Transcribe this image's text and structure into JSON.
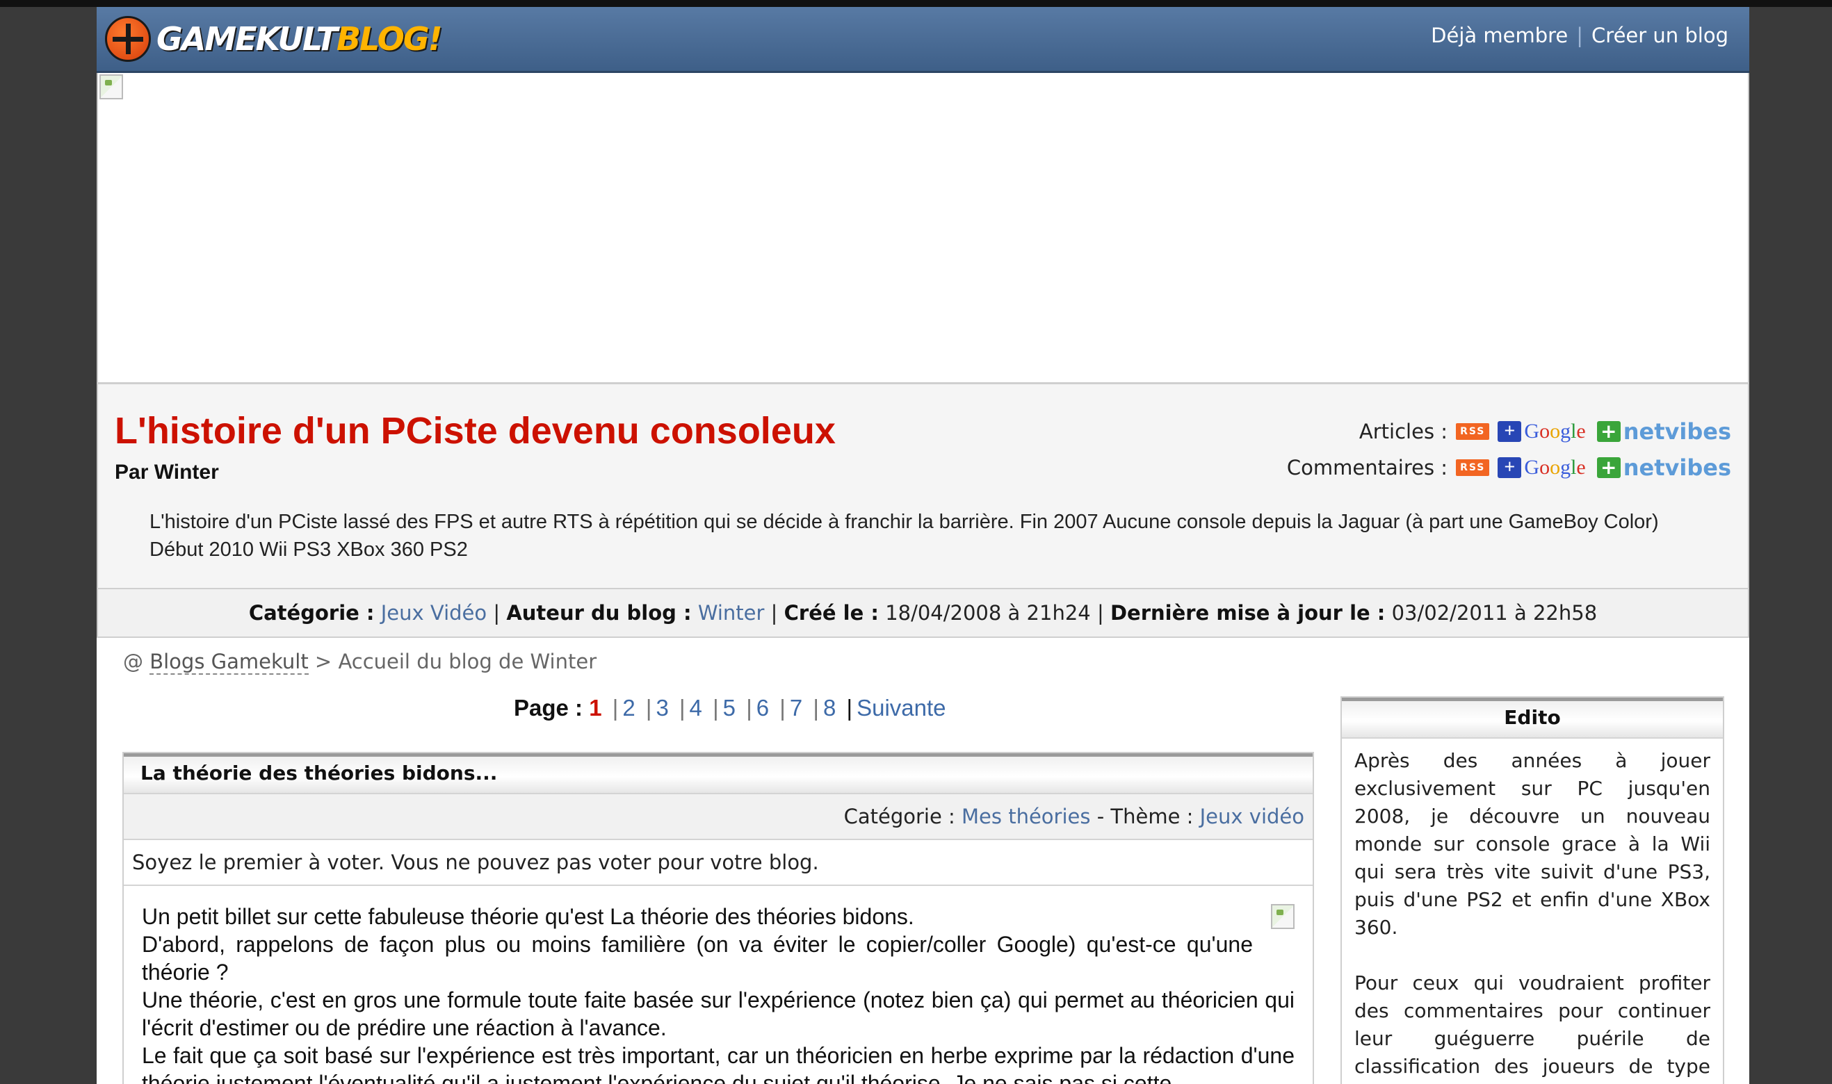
{
  "header": {
    "logo_main": "GAMEKULT",
    "logo_blog": "BLOG!",
    "link_member": "Déjà membre",
    "link_separator": "|",
    "link_create": "Créer un blog"
  },
  "blog": {
    "title": "L'histoire d'un PCiste devenu consoleux",
    "author": "Par Winter",
    "description": "L'histoire d'un PCiste lassé des FPS et autre RTS à répétition qui se décide à franchir la barrière. Fin 2007 Aucune console depuis la Jaguar (à part une GameBoy Color) Début 2010 Wii PS3 XBox 360 PS2"
  },
  "feeds": {
    "articles_label": "Articles :",
    "comments_label": "Commentaires :",
    "rss": "RSS",
    "google": [
      "G",
      "o",
      "o",
      "g",
      "l",
      "e"
    ],
    "netvibes": "netvibes"
  },
  "meta": {
    "category_label": "Catégorie :",
    "category_value": "Jeux Vidéo",
    "author_label": "Auteur du blog :",
    "author_value": "Winter",
    "created_label": "Créé le :",
    "created_value": "18/04/2008 à 21h24",
    "updated_label": "Dernière mise à jour le :",
    "updated_value": "03/02/2011 à 22h58",
    "separator": "|"
  },
  "breadcrumb": {
    "prefix": "@",
    "home": "Blogs Gamekult",
    "current": "> Accueil du blog de Winter"
  },
  "pagination": {
    "label": "Page :",
    "current": "1",
    "pages": [
      "2",
      "3",
      "4",
      "5",
      "6",
      "7",
      "8"
    ],
    "next": "Suivante"
  },
  "article": {
    "title": "La théorie des théories bidons...",
    "category_label": "Catégorie :",
    "category_value": "Mes théories",
    "theme_label": "- Thème :",
    "theme_value": "Jeux vidéo",
    "vote_text": "Soyez le premier à voter. Vous ne pouvez pas voter pour votre blog.",
    "paragraphs": [
      "Un petit billet sur cette fabuleuse théorie qu'est La théorie des théories bidons.",
      "D'abord, rappelons de façon plus ou moins familière (on va éviter le copier/coller Google) qu'est-ce qu'une théorie ?",
      "Une théorie, c'est en gros une formule toute faite basée sur l'expérience (notez bien ça) qui permet au théoricien qui l'écrit d'estimer ou de prédire une réaction à l'avance.",
      "Le fait que ça soit basé sur l'expérience est très important, car un théoricien en herbe exprime par la rédaction d'une théorie justement l'éventualité qu'il a justement l'expérience du sujet qu'il théorise. Je ne sais pas si cette"
    ]
  },
  "edito": {
    "title": "Edito",
    "paragraphs": [
      "Après des années à jouer exclusivement sur PC jusqu'en 2008, je découvre un nouveau monde sur console grace à la Wii qui sera très vite suivit d'une PS3, puis d'une PS2 et enfin d'une XBox 360.",
      "Pour ceux qui voudraient profiter des commentaires pour continuer leur guéguerre puérile de classification des joueurs de type NSex/Sonyais/Bouzeux, je vous invite à aller voir ailleurs"
    ]
  }
}
